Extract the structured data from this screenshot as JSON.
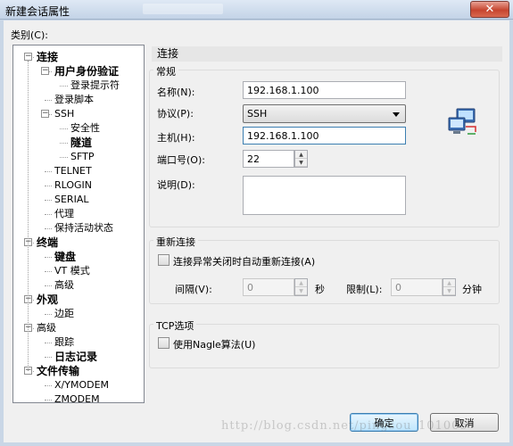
{
  "window": {
    "title": "新建会话属性",
    "close_label": "✕"
  },
  "category_label": "类别(C):",
  "tree": [
    {
      "label": "连接",
      "bold": true,
      "level": 0,
      "expander": "minus"
    },
    {
      "label": "用户身份验证",
      "bold": true,
      "level": 1,
      "expander": "minus"
    },
    {
      "label": "登录提示符",
      "bold": false,
      "level": 2
    },
    {
      "label": "登录脚本",
      "bold": false,
      "level": 1
    },
    {
      "label": "SSH",
      "bold": false,
      "level": 1,
      "expander": "minus"
    },
    {
      "label": "安全性",
      "bold": false,
      "level": 2
    },
    {
      "label": "隧道",
      "bold": true,
      "level": 2
    },
    {
      "label": "SFTP",
      "bold": false,
      "level": 2
    },
    {
      "label": "TELNET",
      "bold": false,
      "level": 1
    },
    {
      "label": "RLOGIN",
      "bold": false,
      "level": 1
    },
    {
      "label": "SERIAL",
      "bold": false,
      "level": 1
    },
    {
      "label": "代理",
      "bold": false,
      "level": 1
    },
    {
      "label": "保持活动状态",
      "bold": false,
      "level": 1
    },
    {
      "label": "终端",
      "bold": true,
      "level": 0,
      "expander": "minus"
    },
    {
      "label": "键盘",
      "bold": true,
      "level": 1
    },
    {
      "label": "VT 模式",
      "bold": false,
      "level": 1
    },
    {
      "label": "高级",
      "bold": false,
      "level": 1
    },
    {
      "label": "外观",
      "bold": true,
      "level": 0,
      "expander": "minus"
    },
    {
      "label": "边距",
      "bold": false,
      "level": 1
    },
    {
      "label": "高级",
      "bold": false,
      "level": 0,
      "expander": "minus"
    },
    {
      "label": "跟踪",
      "bold": false,
      "level": 1
    },
    {
      "label": "日志记录",
      "bold": true,
      "level": 1
    },
    {
      "label": "文件传输",
      "bold": true,
      "level": 0,
      "expander": "minus"
    },
    {
      "label": "X/YMODEM",
      "bold": false,
      "level": 1
    },
    {
      "label": "ZMODEM",
      "bold": false,
      "level": 1
    }
  ],
  "panel": {
    "header": "连接",
    "general": {
      "title": "常规",
      "name_label": "名称(N):",
      "name_value": "192.168.1.100",
      "protocol_label": "协议(P):",
      "protocol_value": "SSH",
      "host_label": "主机(H):",
      "host_value": "192.168.1.100",
      "port_label": "端口号(O):",
      "port_value": "22",
      "desc_label": "说明(D):",
      "desc_value": ""
    },
    "reconnect": {
      "title": "重新连接",
      "checkbox_label": "连接异常关闭时自动重新连接(A)",
      "checked": false,
      "interval_label": "间隔(V):",
      "interval_value": "0",
      "interval_unit": "秒",
      "limit_label": "限制(L):",
      "limit_value": "0",
      "limit_unit": "分钟"
    },
    "tcp": {
      "title": "TCP选项",
      "checkbox_label": "使用Nagle算法(U)",
      "checked": false
    }
  },
  "buttons": {
    "ok": "确定",
    "cancel": "取消"
  },
  "watermark": "http://blog.csdn.net/pingsou_101005"
}
